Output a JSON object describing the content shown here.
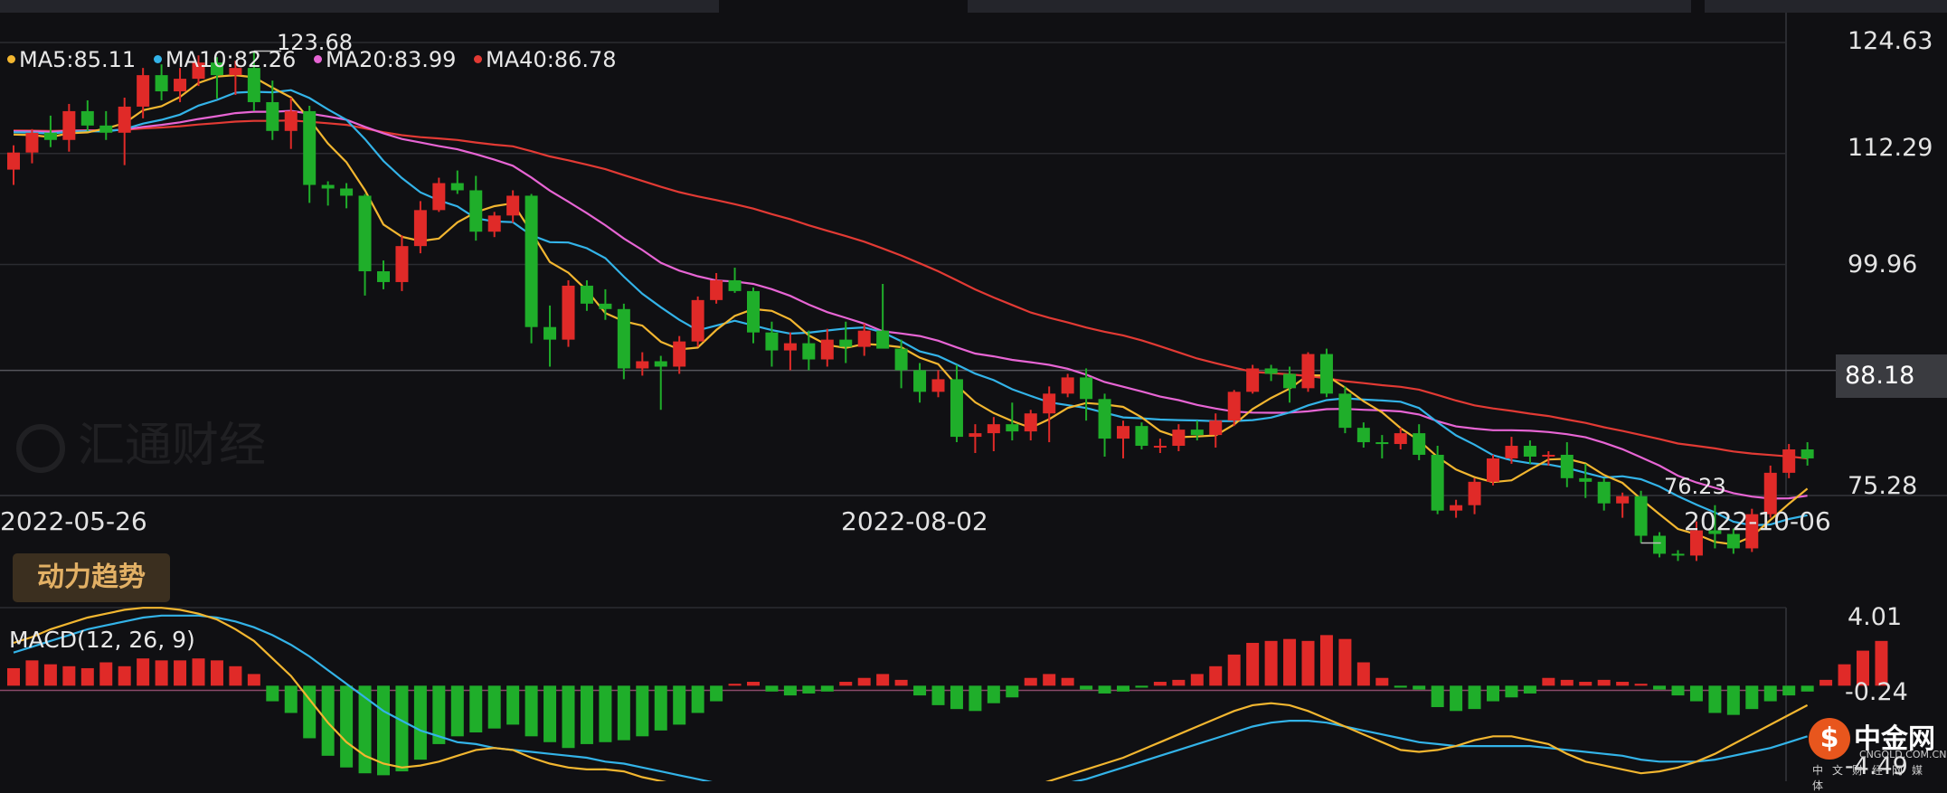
{
  "chart_data": [
    {
      "type": "candlestick",
      "ylim": [
        75.28,
        124.63
      ],
      "y_ticks": [
        "124.63",
        "112.29",
        "99.96",
        "88.18",
        "75.28"
      ],
      "x_tick_labels": [
        "2022-05-26",
        "2022-08-02",
        "2022-10-06"
      ],
      "x_tick_index": [
        0,
        45,
        95
      ],
      "last_price": "88.18",
      "high_label": "123.68",
      "low_label": "76.23",
      "high_index": 13,
      "low_index": 88,
      "legend": [
        {
          "name": "MA5",
          "label": "MA5:85.11",
          "color": "#f2b630"
        },
        {
          "name": "MA10",
          "label": "MA10:82.26",
          "color": "#33b3e8"
        },
        {
          "name": "MA20",
          "label": "MA20:83.99",
          "color": "#e765d4"
        },
        {
          "name": "MA40",
          "label": "MA40:86.78",
          "color": "#e23a34"
        }
      ],
      "candles": [
        [
          110.5,
          113.2,
          108.8,
          112.4
        ],
        [
          112.4,
          115.0,
          111.2,
          114.6
        ],
        [
          114.6,
          116.5,
          113.0,
          113.8
        ],
        [
          113.8,
          117.8,
          112.5,
          117.0
        ],
        [
          117.0,
          118.2,
          114.8,
          115.4
        ],
        [
          115.4,
          117.0,
          113.8,
          114.6
        ],
        [
          114.6,
          118.5,
          111.0,
          117.5
        ],
        [
          117.5,
          121.8,
          116.2,
          121.0
        ],
        [
          121.0,
          122.2,
          118.2,
          119.2
        ],
        [
          119.2,
          121.8,
          118.0,
          120.6
        ],
        [
          120.6,
          123.2,
          119.8,
          122.4
        ],
        [
          122.4,
          123.0,
          118.4,
          121.0
        ],
        [
          121.0,
          122.6,
          118.8,
          121.8
        ],
        [
          121.8,
          123.68,
          117.0,
          118.0
        ],
        [
          118.0,
          120.4,
          113.8,
          114.8
        ],
        [
          114.8,
          118.5,
          112.8,
          117.0
        ],
        [
          117.0,
          117.6,
          106.8,
          108.8
        ],
        [
          108.8,
          109.2,
          106.5,
          108.4
        ],
        [
          108.4,
          109.0,
          106.2,
          107.6
        ],
        [
          107.6,
          107.8,
          96.5,
          99.2
        ],
        [
          99.2,
          100.4,
          97.2,
          98.0
        ],
        [
          98.0,
          103.2,
          97.0,
          102.0
        ],
        [
          102.0,
          107.0,
          101.2,
          106.0
        ],
        [
          106.0,
          109.6,
          105.8,
          109.0
        ],
        [
          109.0,
          110.4,
          107.8,
          108.2
        ],
        [
          108.2,
          109.8,
          102.6,
          103.6
        ],
        [
          103.6,
          105.8,
          103.0,
          105.4
        ],
        [
          105.4,
          108.2,
          104.6,
          107.6
        ],
        [
          107.6,
          107.8,
          91.2,
          93.0
        ],
        [
          93.0,
          95.4,
          88.6,
          91.6
        ],
        [
          91.6,
          98.2,
          90.8,
          97.6
        ],
        [
          97.6,
          98.2,
          94.8,
          95.6
        ],
        [
          95.6,
          97.2,
          93.8,
          95.0
        ],
        [
          95.0,
          95.6,
          87.2,
          88.4
        ],
        [
          88.4,
          90.2,
          87.6,
          89.2
        ],
        [
          89.2,
          89.8,
          83.8,
          88.6
        ],
        [
          88.6,
          92.0,
          87.8,
          91.4
        ],
        [
          91.4,
          96.4,
          90.8,
          96.0
        ],
        [
          96.0,
          99.0,
          95.6,
          98.2
        ],
        [
          98.2,
          99.6,
          96.8,
          97.0
        ],
        [
          97.0,
          97.4,
          91.2,
          92.4
        ],
        [
          92.4,
          93.6,
          88.6,
          90.4
        ],
        [
          90.4,
          92.4,
          88.2,
          91.2
        ],
        [
          91.2,
          92.6,
          88.2,
          89.4
        ],
        [
          89.4,
          92.8,
          88.6,
          91.6
        ],
        [
          91.6,
          93.6,
          89.0,
          90.8
        ],
        [
          90.8,
          93.4,
          89.8,
          92.6
        ],
        [
          92.6,
          97.8,
          91.4,
          90.6
        ],
        [
          90.6,
          91.6,
          86.2,
          88.2
        ],
        [
          88.2,
          89.0,
          84.6,
          85.8
        ],
        [
          85.8,
          88.2,
          85.2,
          87.2
        ],
        [
          87.2,
          88.8,
          80.2,
          80.8
        ],
        [
          80.8,
          82.2,
          79.0,
          81.2
        ],
        [
          81.2,
          83.0,
          79.2,
          82.2
        ],
        [
          82.2,
          84.6,
          80.4,
          81.4
        ],
        [
          81.4,
          83.8,
          80.4,
          83.4
        ],
        [
          83.4,
          86.4,
          80.2,
          85.6
        ],
        [
          85.6,
          87.8,
          85.2,
          87.4
        ],
        [
          87.4,
          88.4,
          82.6,
          85.0
        ],
        [
          85.0,
          85.6,
          78.6,
          80.6
        ],
        [
          80.6,
          82.6,
          78.4,
          82.0
        ],
        [
          82.0,
          82.4,
          79.4,
          79.8
        ],
        [
          79.8,
          80.6,
          79.0,
          79.8
        ],
        [
          79.8,
          82.2,
          79.2,
          81.6
        ],
        [
          81.6,
          82.6,
          80.4,
          81.0
        ],
        [
          81.0,
          83.4,
          79.6,
          82.6
        ],
        [
          82.6,
          86.0,
          82.0,
          85.8
        ],
        [
          85.8,
          88.8,
          85.6,
          88.4
        ],
        [
          88.4,
          88.8,
          87.0,
          87.8
        ],
        [
          87.8,
          88.6,
          84.6,
          86.2
        ],
        [
          86.2,
          90.2,
          85.8,
          90.0
        ],
        [
          90.0,
          90.6,
          85.2,
          85.6
        ],
        [
          85.6,
          86.4,
          81.2,
          81.8
        ],
        [
          81.8,
          82.4,
          79.6,
          80.2
        ],
        [
          80.2,
          81.0,
          78.4,
          80.0
        ],
        [
          80.0,
          81.8,
          79.4,
          81.2
        ],
        [
          81.2,
          82.2,
          78.2,
          78.8
        ],
        [
          78.8,
          79.8,
          72.2,
          72.6
        ],
        [
          72.6,
          73.8,
          71.8,
          73.2
        ],
        [
          73.2,
          76.2,
          72.2,
          75.8
        ],
        [
          75.8,
          78.8,
          75.4,
          78.4
        ],
        [
          78.4,
          80.8,
          77.8,
          79.8
        ],
        [
          79.8,
          80.4,
          77.8,
          78.6
        ],
        [
          78.6,
          79.2,
          77.6,
          78.8
        ],
        [
          78.8,
          80.2,
          75.2,
          76.2
        ],
        [
          76.2,
          77.8,
          74.0,
          75.8
        ],
        [
          75.8,
          76.2,
          72.6,
          73.4
        ],
        [
          73.4,
          74.6,
          71.8,
          74.2
        ],
        [
          74.2,
          74.8,
          69.0,
          69.8
        ],
        [
          69.8,
          70.2,
          67.4,
          67.8
        ],
        [
          67.8,
          68.2,
          67.0,
          67.6
        ],
        [
          67.6,
          71.4,
          67.0,
          70.4
        ],
        [
          70.4,
          73.2,
          68.4,
          70.0
        ],
        [
          70.0,
          70.6,
          67.8,
          68.4
        ],
        [
          68.4,
          72.8,
          68.0,
          72.2
        ],
        [
          72.2,
          77.6,
          71.8,
          76.8
        ],
        [
          76.8,
          80.0,
          76.2,
          79.4
        ],
        [
          79.4,
          80.2,
          77.6,
          78.4
        ]
      ]
    },
    {
      "type": "bar",
      "name": "MACD(12, 26, 9)",
      "ylim": [
        -4.49,
        4.01
      ],
      "y_ticks": [
        "4.01",
        "-0.24",
        "-4.49"
      ],
      "histogram": [
        0.9,
        1.3,
        1.1,
        1.0,
        0.9,
        1.2,
        1.0,
        1.4,
        1.3,
        1.3,
        1.4,
        1.3,
        1.0,
        0.6,
        -0.8,
        -1.4,
        -2.7,
        -3.6,
        -4.2,
        -4.5,
        -4.6,
        -4.4,
        -3.8,
        -3.0,
        -2.6,
        -2.4,
        -2.2,
        -2.0,
        -2.6,
        -2.9,
        -3.2,
        -3.0,
        -2.9,
        -2.8,
        -2.6,
        -2.3,
        -2.0,
        -1.4,
        -0.8,
        0.1,
        0.2,
        -0.3,
        -0.5,
        -0.4,
        -0.3,
        0.2,
        0.4,
        0.6,
        0.3,
        -0.5,
        -1.0,
        -1.2,
        -1.3,
        -0.9,
        -0.6,
        0.4,
        0.6,
        0.4,
        -0.2,
        -0.4,
        -0.3,
        -0.1,
        0.2,
        0.3,
        0.6,
        1.0,
        1.6,
        2.2,
        2.3,
        2.4,
        2.3,
        2.6,
        2.4,
        1.2,
        0.4,
        -0.1,
        -0.2,
        -1.1,
        -1.3,
        -1.2,
        -0.8,
        -0.6,
        -0.4,
        0.4,
        0.3,
        0.2,
        0.3,
        0.2,
        0.1,
        -0.2,
        -0.5,
        -0.8,
        -1.4,
        -1.5,
        -1.2,
        -0.8,
        -0.5,
        -0.3,
        0.3,
        1.1,
        1.8,
        2.3
      ],
      "dif": [
        2.2,
        2.5,
        2.9,
        3.2,
        3.5,
        3.7,
        3.9,
        4.0,
        4.0,
        3.9,
        3.7,
        3.4,
        2.9,
        2.3,
        1.4,
        0.5,
        -0.7,
        -1.9,
        -2.9,
        -3.6,
        -4.0,
        -4.2,
        -4.1,
        -3.9,
        -3.6,
        -3.3,
        -3.2,
        -3.3,
        -3.7,
        -4.0,
        -4.2,
        -4.3,
        -4.3,
        -4.4,
        -4.7,
        -4.9,
        -5.1,
        -5.3,
        -5.5,
        -5.4,
        -5.3,
        -5.4,
        -5.5,
        -5.5,
        -5.5,
        -5.3,
        -5.2,
        -5.1,
        -5.2,
        -5.4,
        -5.6,
        -5.7,
        -5.8,
        -5.6,
        -5.5,
        -5.2,
        -4.9,
        -4.6,
        -4.3,
        -4.0,
        -3.7,
        -3.3,
        -2.9,
        -2.5,
        -2.1,
        -1.7,
        -1.3,
        -1.0,
        -0.9,
        -1.0,
        -1.3,
        -1.7,
        -2.1,
        -2.5,
        -2.9,
        -3.3,
        -3.4,
        -3.3,
        -3.1,
        -2.8,
        -2.6,
        -2.6,
        -2.8,
        -3.0,
        -3.5,
        -3.9,
        -4.1,
        -4.3,
        -4.5,
        -4.4,
        -4.2,
        -3.9,
        -3.5,
        -3.0,
        -2.5,
        -2.0,
        -1.5,
        -1.0
      ],
      "dea": [
        1.7,
        2.0,
        2.3,
        2.6,
        2.9,
        3.1,
        3.3,
        3.5,
        3.6,
        3.6,
        3.6,
        3.5,
        3.3,
        3.0,
        2.6,
        2.1,
        1.5,
        0.8,
        0.1,
        -0.6,
        -1.3,
        -1.8,
        -2.3,
        -2.6,
        -2.9,
        -3.0,
        -3.2,
        -3.3,
        -3.4,
        -3.5,
        -3.6,
        -3.7,
        -3.9,
        -4.0,
        -4.2,
        -4.4,
        -4.6,
        -4.8,
        -5.0,
        -5.1,
        -5.2,
        -5.3,
        -5.4,
        -5.4,
        -5.4,
        -5.5,
        -5.5,
        -5.6,
        -5.6,
        -5.6,
        -5.6,
        -5.6,
        -5.6,
        -5.6,
        -5.5,
        -5.4,
        -5.2,
        -5.0,
        -4.8,
        -4.5,
        -4.2,
        -3.9,
        -3.6,
        -3.3,
        -3.0,
        -2.7,
        -2.4,
        -2.1,
        -1.9,
        -1.8,
        -1.8,
        -1.9,
        -2.1,
        -2.3,
        -2.5,
        -2.7,
        -2.9,
        -3.0,
        -3.1,
        -3.1,
        -3.1,
        -3.1,
        -3.1,
        -3.2,
        -3.3,
        -3.4,
        -3.5,
        -3.6,
        -3.8,
        -3.9,
        -3.9,
        -3.9,
        -3.8,
        -3.6,
        -3.4,
        -3.2,
        -2.9,
        -2.6
      ]
    }
  ],
  "colors": {
    "up": "#e02a28",
    "down": "#1fae2a",
    "background": "#101013",
    "grid": "#2b2c31",
    "text": "#e3e3e3"
  },
  "indicator_tab": {
    "label": "动力趋势"
  },
  "watermark": {
    "text": "汇通财经"
  },
  "brand": {
    "name": "中金网",
    "domain": "CNGOLD.COM.CN",
    "tagline": "中文财经网媒体"
  }
}
